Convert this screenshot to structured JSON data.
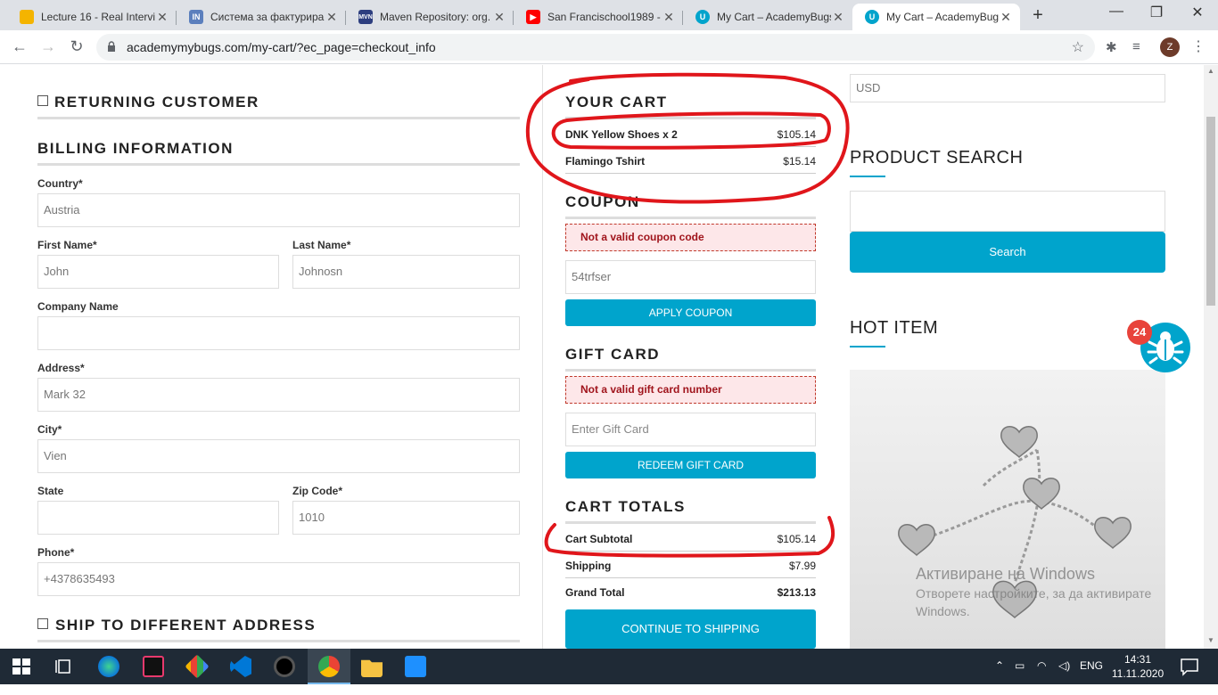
{
  "browser": {
    "tabs": [
      {
        "title": "Lecture 16 - Real Intervi",
        "icon": "google-drive-icon"
      },
      {
        "title": "Система за фактуриране",
        "icon": "invoice-icon"
      },
      {
        "title": "Maven Repository: org.",
        "icon": "maven-icon"
      },
      {
        "title": "San Francischool1989 -",
        "icon": "youtube-icon"
      },
      {
        "title": "My Cart – AcademyBugs",
        "icon": "academybugs-icon"
      },
      {
        "title": "My Cart – AcademyBugs",
        "icon": "academybugs-icon"
      }
    ],
    "url": "academymybugs.com/my-cart/?ec_page=checkout_info",
    "profile_initial": "Z"
  },
  "checkout": {
    "returning_customer": "RETURNING CUSTOMER",
    "billing_heading": "BILLING INFORMATION",
    "fields": {
      "country": {
        "label": "Country*",
        "value": "Austria"
      },
      "first_name": {
        "label": "First Name*",
        "value": "John"
      },
      "last_name": {
        "label": "Last Name*",
        "value": "Johnosn"
      },
      "company": {
        "label": "Company Name",
        "value": ""
      },
      "address": {
        "label": "Address*",
        "value": "Mark 32"
      },
      "city": {
        "label": "City*",
        "value": "Vien"
      },
      "state": {
        "label": "State",
        "value": ""
      },
      "zip": {
        "label": "Zip Code*",
        "value": "1010"
      },
      "phone": {
        "label": "Phone*",
        "value": "+4378635493"
      }
    },
    "ship_different": "SHIP TO DIFFERENT ADDRESS"
  },
  "cart": {
    "heading": "YOUR CART",
    "items": [
      {
        "name": "DNK Yellow Shoes x 2",
        "price": "$105.14"
      },
      {
        "name": "Flamingo Tshirt",
        "price": "$15.14"
      }
    ],
    "coupon": {
      "heading": "COUPON",
      "error": "Not a valid coupon code",
      "value": "54trfser",
      "button": "APPLY COUPON"
    },
    "gift_card": {
      "heading": "GIFT CARD",
      "error": "Not a valid gift card number",
      "placeholder": "Enter Gift Card",
      "button": "REDEEM GIFT CARD"
    },
    "totals": {
      "heading": "CART TOTALS",
      "rows": [
        {
          "label": "Cart Subtotal",
          "value": "$105.14"
        },
        {
          "label": "Shipping",
          "value": "$7.99"
        },
        {
          "label": "Grand Total",
          "value": "$213.13"
        }
      ],
      "button": "CONTINUE TO SHIPPING"
    }
  },
  "sidebar": {
    "currency": "USD",
    "product_search": "PRODUCT SEARCH",
    "search_button": "Search",
    "hot_item": "HOT ITEM",
    "bug_count": "24"
  },
  "watermark": {
    "line1": "Активиране на Windows",
    "line2": "Отворете настройките, за да активирате",
    "line3": "Windows."
  },
  "taskbar": {
    "language": "ENG",
    "time": "14:31",
    "date": "11.11.2020 г."
  }
}
